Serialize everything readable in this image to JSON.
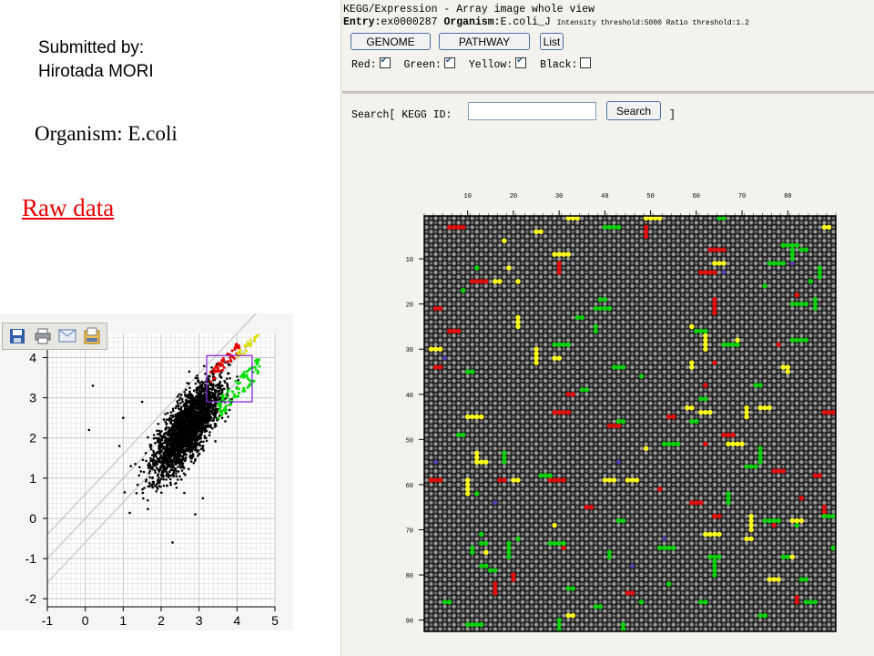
{
  "slide": {
    "submitted_label": "Submitted by:",
    "submitter_name": "Hirotada MORI",
    "organism_text": "Organism: E.coli",
    "raw_data_link": "Raw data"
  },
  "kegg": {
    "title": "KEGG/Expression - Array image whole view",
    "entry_label": "Entry:",
    "entry_value": "ex0000287",
    "organism_label": "Organism:",
    "organism_value": "E.coli_J",
    "thresholds": "Intensity threshold:5000 Ratio threshold:1.2",
    "buttons": {
      "genome": "GENOME",
      "pathway": "PATHWAY",
      "list": "List"
    },
    "filters": [
      {
        "label": "Red:",
        "checked": true
      },
      {
        "label": "Green:",
        "checked": true
      },
      {
        "label": "Yellow:",
        "checked": true
      },
      {
        "label": "Black:",
        "checked": false
      }
    ],
    "search": {
      "prefix": "Search[ KEGG ID:",
      "suffix": "]",
      "button": "Search",
      "value": ""
    },
    "array": {
      "col_labels": [
        "10",
        "20",
        "30",
        "40",
        "50",
        "60",
        "70",
        "80"
      ],
      "row_labels": [
        "10",
        "20",
        "30",
        "40",
        "50",
        "60",
        "70",
        "80",
        "90"
      ],
      "colors": {
        "red": "#e01010",
        "green": "#10d010",
        "yellow": "#ffff20",
        "grid_bg": "#202020",
        "spot": "#9a9a9a"
      }
    }
  },
  "scatter": {
    "toolbar_icons": [
      "save-icon",
      "print-icon",
      "mail-icon",
      "export-icon"
    ],
    "chart_data": {
      "type": "scatter",
      "x_ticks": [
        "-1",
        "0",
        "1",
        "2",
        "3",
        "4",
        "5"
      ],
      "y_ticks": [
        "4",
        "3",
        "2",
        "1",
        "0",
        "-1",
        "-2"
      ],
      "xlim": [
        -1,
        5
      ],
      "ylim": [
        -2.2,
        4.6
      ],
      "grid": true,
      "selection_box": {
        "x": [
          3.2,
          4.4
        ],
        "y": [
          2.9,
          4.05
        ]
      },
      "series_colors": {
        "black": "#000000",
        "red": "#e00000",
        "green": "#00e000",
        "yellow": "#e0e000"
      }
    }
  }
}
